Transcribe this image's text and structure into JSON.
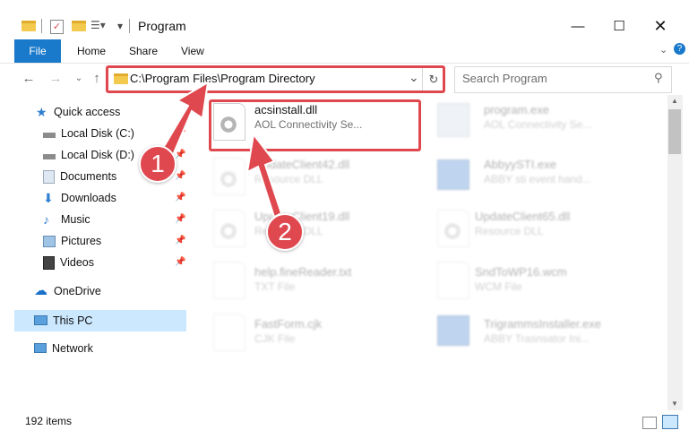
{
  "window": {
    "title": "Program",
    "controls": [
      "minimize",
      "maximize",
      "close"
    ]
  },
  "ribbon": {
    "tabs": [
      "File",
      "Home",
      "Share",
      "View"
    ]
  },
  "address": {
    "path": "C:\\Program Files\\Program Directory",
    "search_placeholder": "Search Program"
  },
  "sidebar": {
    "quick_access": "Quick access",
    "items": [
      {
        "label": "Local Disk (C:)",
        "icon": "drive-icon",
        "pinned": true
      },
      {
        "label": "Local Disk (D:)",
        "icon": "drive-icon",
        "pinned": true
      },
      {
        "label": "Documents",
        "icon": "documents-icon",
        "pinned": true
      },
      {
        "label": "Downloads",
        "icon": "download-icon",
        "pinned": true
      },
      {
        "label": "Music",
        "icon": "music-icon",
        "pinned": true
      },
      {
        "label": "Pictures",
        "icon": "pictures-icon",
        "pinned": true
      },
      {
        "label": "Videos",
        "icon": "videos-icon",
        "pinned": true
      }
    ],
    "onedrive": "OneDrive",
    "thispc": "This PC",
    "network": "Network"
  },
  "files": [
    {
      "name": "acsinstall.dll",
      "desc": "AOL Connectivity Se..."
    },
    {
      "name": "program.exe",
      "desc": "AOL Connectivity Se..."
    },
    {
      "name": "UpdateClient42.dll",
      "desc": "Resource DLL"
    },
    {
      "name": "AbbyySTI.exe",
      "desc": "ABBY sti event hand..."
    },
    {
      "name": "UpdateClient19.dll",
      "desc": "Resource DLL"
    },
    {
      "name": "UpdateClient65.dll",
      "desc": "Resource DLL"
    },
    {
      "name": "help.fineReader.txt",
      "desc": "TXT File"
    },
    {
      "name": "SndToWP16.wcm",
      "desc": "WCM File"
    },
    {
      "name": "FastForm.cjk",
      "desc": "CJK File"
    },
    {
      "name": "TrigrammsInstaller.exe",
      "desc": "ABBY Trasnsator Ini..."
    }
  ],
  "status": {
    "items": "192 items"
  },
  "annotations": {
    "step1": "1",
    "step2": "2"
  },
  "colors": {
    "accent": "#1979ca",
    "highlight": "#e0484f",
    "selection": "#cce8ff"
  }
}
